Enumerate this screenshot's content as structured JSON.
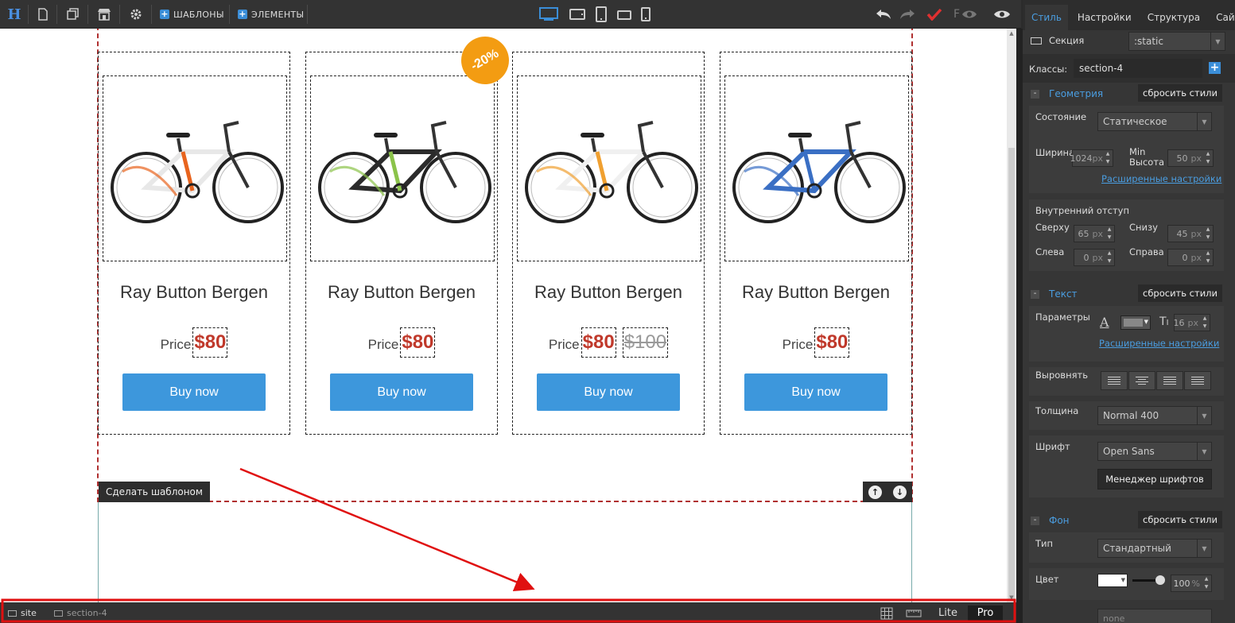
{
  "toolbar": {
    "logo": "H",
    "templates_label": "ШАБЛОНЫ",
    "elements_label": "ЭЛЕМЕНТЫ",
    "f_label": "F"
  },
  "canvas": {
    "badge": "-20%",
    "make_template_label": "Сделать шаблоном",
    "products": [
      {
        "title": "Ray Button Bergen",
        "price_label": "Price",
        "price": "$80",
        "old_price": "",
        "button": "Buy now",
        "frame_color": "#e8e8e8",
        "accent_color": "#e8641e"
      },
      {
        "title": "Ray Button Bergen",
        "price_label": "Price",
        "price": "$80",
        "old_price": "",
        "button": "Buy now",
        "frame_color": "#2b2b2b",
        "accent_color": "#8bc34a"
      },
      {
        "title": "Ray Button Bergen",
        "price_label": "Price",
        "price": "$80",
        "old_price": "$100",
        "button": "Buy now",
        "frame_color": "#f0f0f0",
        "accent_color": "#f0a030"
      },
      {
        "title": "Ray Button Bergen",
        "price_label": "Price",
        "price": "$80",
        "old_price": "",
        "button": "Buy now",
        "frame_color": "#3a6fc4",
        "accent_color": "#3a6fc4"
      }
    ]
  },
  "statusbar": {
    "crumbs": [
      "site",
      "section-4"
    ],
    "lite_label": "Lite",
    "pro_label": "Pro"
  },
  "panel": {
    "tabs": [
      "Стиль",
      "Настройки",
      "Структура",
      "Сайт"
    ],
    "section_label": "Секция",
    "state_select": ":static",
    "classes_label": "Классы:",
    "classes_value": "section-4",
    "reset_label": "сбросить стили",
    "geometry": {
      "title": "Геометрия",
      "state_label": "Состояние",
      "state_value": "Статическое",
      "width_label": "Ширина",
      "width_value": "1024",
      "width_unit": "px",
      "minheight_label_1": "Min",
      "minheight_label_2": "Высота",
      "minheight_value": "50",
      "minheight_unit": "px",
      "advanced_link": "Расширенные настройки",
      "padding_label": "Внутренний отступ",
      "top_label": "Сверху",
      "top_value": "65",
      "bottom_label": "Снизу",
      "bottom_value": "45",
      "left_label": "Слева",
      "left_value": "0",
      "right_label": "Справа",
      "right_value": "0",
      "unit": "px"
    },
    "text": {
      "title": "Текст",
      "params_label": "Параметры",
      "font_size": "16",
      "font_size_unit": "px",
      "advanced_link": "Расширенные настройки",
      "align_label": "Выровнять",
      "weight_label": "Толщина",
      "weight_value": "Normal 400",
      "font_label": "Шрифт",
      "font_value": "Open Sans",
      "font_manager": "Менеджер шрифтов"
    },
    "bg": {
      "title": "Фон",
      "type_label": "Тип",
      "type_value": "Стандартный",
      "color_label": "Цвет",
      "opacity_value": "100",
      "opacity_unit": "%",
      "image_value": "none"
    }
  },
  "colors": {
    "accent": "#4a9de0",
    "buy_button": "#3d97dc",
    "price": "#c0392b",
    "badge": "#f39c12",
    "annotation": "#e01010"
  }
}
